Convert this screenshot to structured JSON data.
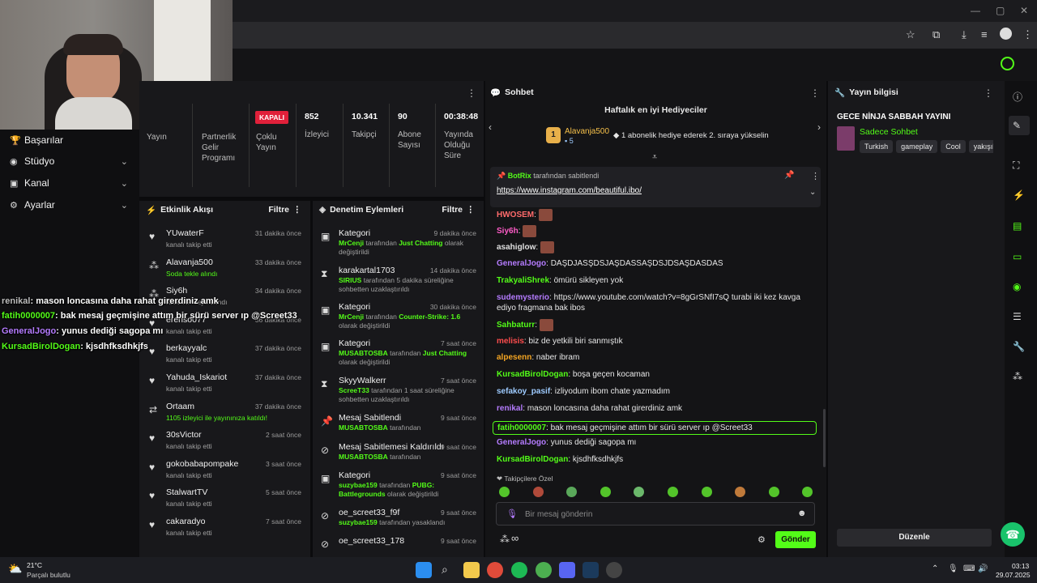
{
  "leftnav": {
    "items": [
      {
        "label": "Başarılar",
        "icon": "trophy-icon"
      },
      {
        "label": "Stüdyo",
        "icon": "camera-icon"
      },
      {
        "label": "Kanal",
        "icon": "channel-icon"
      },
      {
        "label": "Ayarlar",
        "icon": "gear-icon"
      }
    ]
  },
  "overlay_chat": [
    {
      "user": "renikal",
      "text": ": mason loncasına daha rahat girerdiniz amk",
      "color": "#bdbdbd"
    },
    {
      "user": "fatih0000007",
      "text": ": bak mesaj geçmişine attım bir sürü server ıp @Screet33",
      "color": "#53fc18"
    },
    {
      "user": "GeneralJogo",
      "text": ": yunus dediği sagopa mı",
      "color": "#b57cff"
    },
    {
      "user": "KursadBirolDogan",
      "text": ": kjsdhfksdhkjfs",
      "color": "#53fc18"
    }
  ],
  "stats": {
    "yayin_label": "Yayın",
    "partnerlik_label": "Partnerlik Gelir Programı",
    "coklu_badge": "KAPALI",
    "coklu_label": "Çoklu Yayın",
    "izleyici_value": "852",
    "izleyici_label": "İzleyici",
    "takipci_value": "10.341",
    "takipci_label": "Takipçi",
    "abone_value": "90",
    "abone_label": "Abone Sayısı",
    "sure_value": "00:38:48",
    "sure_label": "Yayında Olduğu Süre"
  },
  "activity": {
    "title": "Etkinlik Akışı",
    "filter": "Filtre",
    "rows": [
      {
        "name": "YUwaterF",
        "sub": "kanalı takip etti",
        "time": "31 dakika önce",
        "icon": "heart-icon"
      },
      {
        "name": "Alavanja500",
        "sub": "Soda tekle alındı",
        "time": "33 dakika önce",
        "icon": "kick-icon"
      },
      {
        "name": "Siy6h",
        "sub": "Kick VIP veya alındı",
        "time": "34 dakika önce",
        "icon": "kick-icon"
      },
      {
        "name": "erenso077",
        "sub": "kanalı takip etti",
        "time": "36 dakika önce",
        "icon": "heart-icon"
      },
      {
        "name": "berkayyalc",
        "sub": "kanalı takip etti",
        "time": "37 dakika önce",
        "icon": "heart-icon"
      },
      {
        "name": "Yahuda_Iskariot",
        "sub": "kanalı takip etti",
        "time": "37 dakika önce",
        "icon": "heart-icon"
      },
      {
        "name": "Ortaam",
        "sub": "1105 izleyici ile yayınınıza katıldı!",
        "time": "37 dakika önce",
        "icon": "raid-icon"
      },
      {
        "name": "30sVictor",
        "sub": "kanalı takip etti",
        "time": "2 saat önce",
        "icon": "heart-icon"
      },
      {
        "name": "gokobabapompake",
        "sub": "kanalı takip etti",
        "time": "3 saat önce",
        "icon": "heart-icon"
      },
      {
        "name": "StalwartTV",
        "sub": "kanalı takip etti",
        "time": "5 saat önce",
        "icon": "heart-icon"
      },
      {
        "name": "cakaradyo",
        "sub": "kanalı takip etti",
        "time": "7 saat önce",
        "icon": "heart-icon"
      }
    ]
  },
  "moderation": {
    "title": "Denetim Eylemleri",
    "filter": "Filtre",
    "rows": [
      {
        "name": "Kategori",
        "pre": "MrCenji",
        "mid": " tarafından ",
        "hl": "Just Chatting",
        "post": " olarak değiştirildi",
        "time": "9 dakika önce",
        "icon": "category-icon"
      },
      {
        "name": "karakartal1703",
        "pre": "SIRIUS",
        "mid": " tarafından 5 dakika süreliğine sohbetten uzaklaştırıldı",
        "hl": "",
        "post": "",
        "time": "14 dakika önce",
        "icon": "hourglass-icon"
      },
      {
        "name": "Kategori",
        "pre": "MrCenji",
        "mid": " tarafından ",
        "hl": "Counter-Strike: 1.6",
        "post": " olarak değiştirildi",
        "time": "30 dakika önce",
        "icon": "category-icon"
      },
      {
        "name": "Kategori",
        "pre": "MUSABTOSBA",
        "mid": " tarafından ",
        "hl": "Just Chatting",
        "post": " olarak değiştirildi",
        "time": "7 saat önce",
        "icon": "category-icon"
      },
      {
        "name": "SkyyWalkerr",
        "pre": "ScreeT33",
        "mid": " tarafından 1 saat süreliğine sohbetten uzaklaştırıldı",
        "hl": "",
        "post": "",
        "time": "7 saat önce",
        "icon": "hourglass-icon"
      },
      {
        "name": "Mesaj Sabitlendi",
        "pre": "MUSABTOSBA",
        "mid": " tarafından",
        "hl": "",
        "post": "",
        "time": "9 saat önce",
        "icon": "pin-icon"
      },
      {
        "name": "Mesaj Sabitlemesi Kaldırıldı",
        "pre": "MUSABTOSBA",
        "mid": " tarafından",
        "hl": "",
        "post": "",
        "time": "9 saat önce",
        "icon": "unpin-icon"
      },
      {
        "name": "Kategori",
        "pre": "suzybae159",
        "mid": " tarafından ",
        "hl": "PUBG: Battlegrounds",
        "post": " olarak değiştirildi",
        "time": "9 saat önce",
        "icon": "category-icon"
      },
      {
        "name": "oe_screet33_f9f",
        "pre": "suzybae159",
        "mid": " tarafından yasaklandı",
        "hl": "",
        "post": "",
        "time": "9 saat önce",
        "icon": "ban-icon"
      },
      {
        "name": "oe_screet33_178",
        "pre": "",
        "mid": "",
        "hl": "",
        "post": "",
        "time": "9 saat önce",
        "icon": "ban-icon"
      }
    ]
  },
  "chat": {
    "title": "Sohbet",
    "top_gifters_title": "Haftalık en iyi Hediyeciler",
    "gifter_rank": "1",
    "gifter_name": "Alavanja500",
    "gifter_count": "5",
    "gifter_note": "1 abonelik hediye ederek 2. sıraya yükselin",
    "pinned_by": "BotRix",
    "pinned_by_suffix": "tarafından sabitlendi",
    "pinned_link": "https://www.instagram.com/beautiful.ibo/",
    "messages": [
      {
        "user": "HWOSEM",
        "text": "",
        "color": "#ff6b6b",
        "emote": true
      },
      {
        "user": "Siy6h",
        "text": "",
        "color": "#ff5cc8",
        "emote": true
      },
      {
        "user": "asahiglow",
        "text": "",
        "color": "#e0e0e0",
        "emote": true
      },
      {
        "user": "GeneralJogo",
        "text": "DAŞDJASŞDSJAŞDASSAŞDSJDSAŞDASDAS",
        "color": "#b57cff",
        "emote": false
      },
      {
        "user": "TrakyaliShrek",
        "text": "ömürü sikleyen yok",
        "color": "#53fc18",
        "emote": false
      },
      {
        "user": "sudemysterio",
        "text": "https://www.youtube.com/watch?v=8gGrSNfI7sQ turabi iki kez kavga ediyo fragmana bak ibos",
        "color": "#b57cff",
        "emote": false
      },
      {
        "user": "Sahbaturr",
        "text": "",
        "color": "#53fc18",
        "emote": true
      },
      {
        "user": "melisis",
        "text": "biz de yetkili biri sanmıştık",
        "color": "#ff4d4d",
        "emote": false
      },
      {
        "user": "alpesenn",
        "text": "naber ibram",
        "color": "#f5a623",
        "emote": false
      },
      {
        "user": "KursadBirolDogan",
        "text": "boşa geçen kocaman",
        "color": "#53fc18",
        "emote": false
      },
      {
        "user": "sefakoy_pasif",
        "text": "izliyodum ibom chate yazmadım",
        "color": "#9ecbff",
        "emote": false
      },
      {
        "user": "renikal",
        "text": "mason loncasına daha rahat girerdiniz amk",
        "color": "#b57cff",
        "emote": false
      },
      {
        "user": "fatih0000007",
        "text": "bak mesaj geçmişine attım bir sürü server ıp @Screet33",
        "color": "#53fc18",
        "emote": false
      },
      {
        "user": "GeneralJogo",
        "text": "yunus dediği sagopa mı",
        "color": "#b57cff",
        "emote": false
      },
      {
        "user": "KursadBirolDogan",
        "text": "kjsdhfksdhkjfs",
        "color": "#53fc18",
        "emote": false
      }
    ],
    "followers_only": "Takipçilere Özel",
    "input_placeholder": "Bir mesaj gönderin",
    "send_label": "Gönder"
  },
  "info": {
    "title": "Yayın bilgisi",
    "stream_title": "GECE NİNJA SABBAH YAYINI",
    "category": "Sadece Sohbet",
    "tags": [
      "Turkish",
      "gameplay",
      "Cool",
      "yakışık"
    ],
    "edit_label": "Düzenle"
  },
  "taskbar": {
    "weather_temp": "21°C",
    "weather_text": "Parçalı bulutlu",
    "time": "03:13",
    "date": "29.07.2025"
  }
}
